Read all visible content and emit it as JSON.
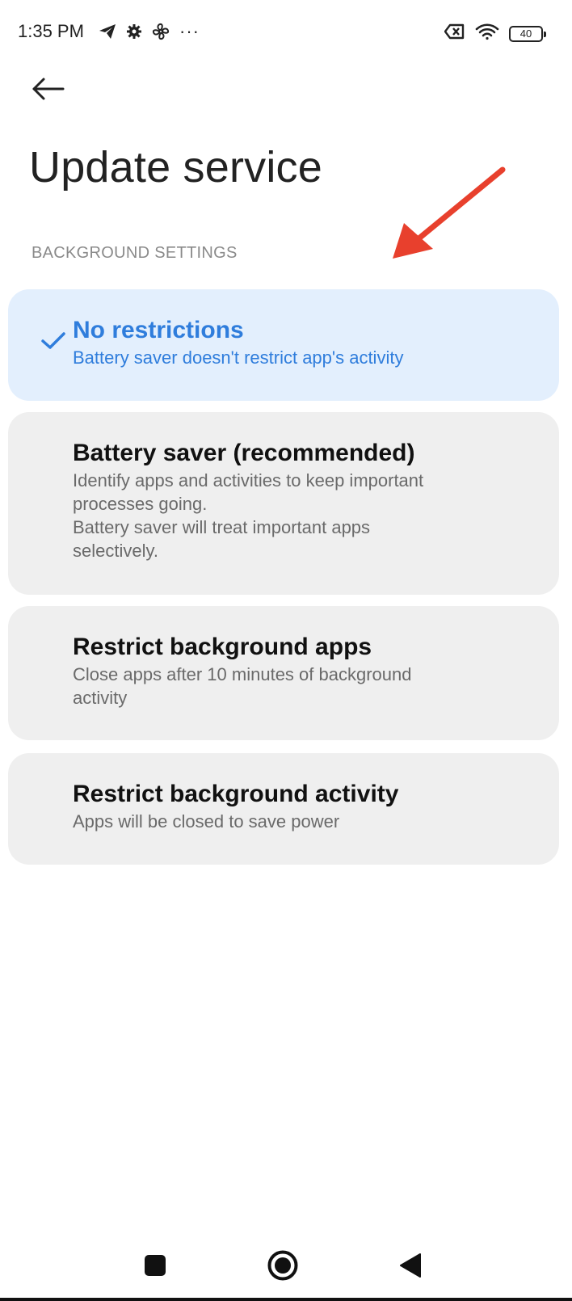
{
  "status_bar": {
    "time": "1:35 PM",
    "left_icons": [
      "telegram-icon",
      "gear-icon",
      "fan-icon",
      "more-icon"
    ],
    "more_glyph": "···",
    "right_icons": [
      "sim-off-icon",
      "wifi-icon",
      "battery-icon"
    ],
    "battery_level": "40"
  },
  "header": {
    "back_icon": "arrow-left-icon",
    "title": "Update service"
  },
  "section": {
    "header": "BACKGROUND SETTINGS"
  },
  "options": [
    {
      "title": "No restrictions",
      "description": "Battery saver doesn't restrict app's activity",
      "selected": true
    },
    {
      "title": "Battery saver (recommended)",
      "description": "Identify apps and activities to keep important\nprocesses going.\nBattery saver will treat important apps\nselectively.",
      "selected": false
    },
    {
      "title": "Restrict background apps",
      "description": "Close apps after 10 minutes of background\nactivity",
      "selected": false
    },
    {
      "title": "Restrict background activity",
      "description": "Apps will be closed to save power",
      "selected": false
    }
  ],
  "navigation_bar": {
    "buttons": [
      "recents-square-icon",
      "home-circle-icon",
      "back-triangle-icon"
    ]
  },
  "colors": {
    "accent": "#2f7ddc",
    "selected_card_bg": "#e3effd",
    "card_bg": "#efefef",
    "annotation_arrow": "#e8402d"
  }
}
